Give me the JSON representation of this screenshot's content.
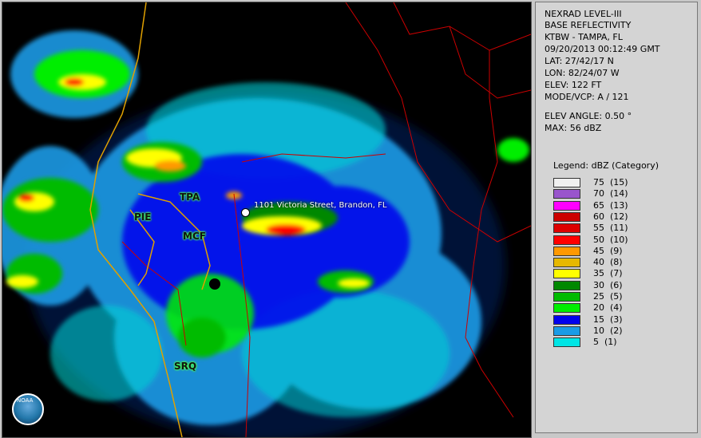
{
  "info": {
    "product": "NEXRAD LEVEL-III",
    "type": "BASE REFLECTIVITY",
    "station": "KTBW - TAMPA, FL",
    "datetime": "09/20/2013 00:12:49 GMT",
    "lat": "LAT: 27/42/17 N",
    "lon": "LON: 82/24/07 W",
    "elev": "ELEV: 122 FT",
    "mode": "MODE/VCP: A / 121",
    "elev_angle": "ELEV ANGLE: 0.50 °",
    "max": "MAX: 56 dBZ"
  },
  "legend": {
    "title": "Legend: dBZ (Category)",
    "items": [
      {
        "label": "75  (15)",
        "color": "#f0f0f0"
      },
      {
        "label": "70  (14)",
        "color": "#9955cc"
      },
      {
        "label": "65  (13)",
        "color": "#ff00ff"
      },
      {
        "label": "60  (12)",
        "color": "#cc0000"
      },
      {
        "label": "55  (11)",
        "color": "#dd0000"
      },
      {
        "label": "50  (10)",
        "color": "#ff0000"
      },
      {
        "label": "45  (9)",
        "color": "#ff9900"
      },
      {
        "label": "40  (8)",
        "color": "#e6b800"
      },
      {
        "label": "35  (7)",
        "color": "#ffff00"
      },
      {
        "label": "30  (6)",
        "color": "#008800"
      },
      {
        "label": "25  (5)",
        "color": "#00bb00"
      },
      {
        "label": "20  (4)",
        "color": "#00ee00"
      },
      {
        "label": "15  (3)",
        "color": "#0000ee"
      },
      {
        "label": "10  (2)",
        "color": "#1a9be6"
      },
      {
        "label": "5  (1)",
        "color": "#00e5e5"
      }
    ]
  },
  "map": {
    "cities": [
      "TPA",
      "PIE",
      "MCF",
      "SRQ"
    ],
    "marker_address": "1101 Victoria Street, Brandon, FL",
    "logo": "NOAA"
  }
}
